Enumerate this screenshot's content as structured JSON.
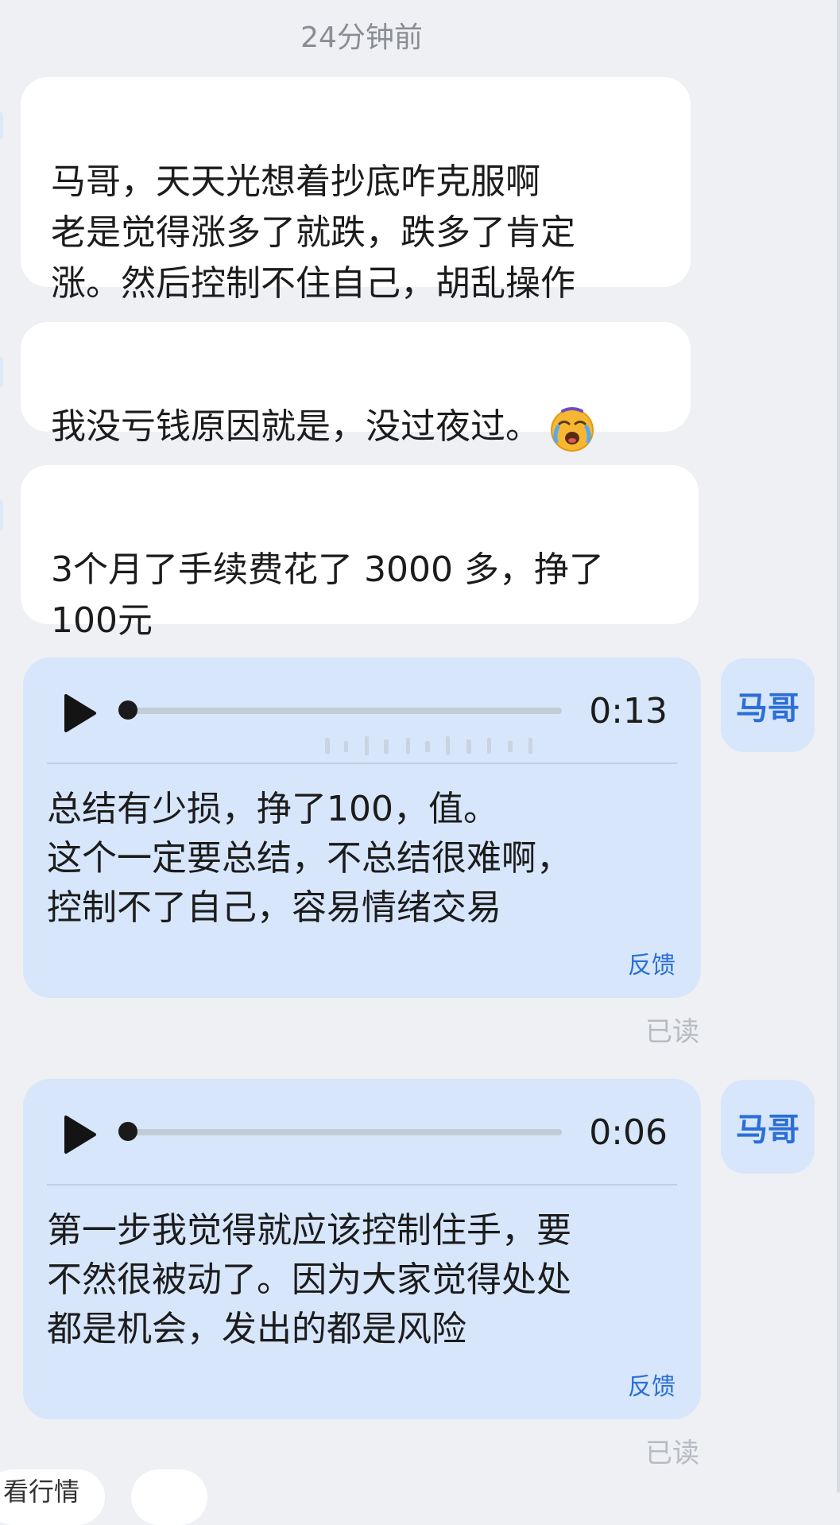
{
  "timestamp": "24分钟前",
  "incoming_messages": [
    {
      "text": "马哥，天天光想着抄底咋克服啊\n老是觉得涨多了就跌，跌多了肯定\n涨。然后控制不住自己，胡乱操作"
    },
    {
      "text": "我没亏钱原因就是，没过夜过。",
      "emoji": "crying-face-emoji"
    },
    {
      "text": "3个月了手续费花了 3000 多，挣了\n100元"
    }
  ],
  "voice_messages": [
    {
      "duration": "0:13",
      "progress": 0,
      "transcript": "总结有少损，挣了100，值。\n这个一定要总结，不总结很难啊，\n控制不了自己，容易情绪交易",
      "feedback_label": "反馈",
      "read_status": "已读",
      "avatar_label": "马哥"
    },
    {
      "duration": "0:06",
      "progress": 0,
      "transcript": "第一步我觉得就应该控制住手，要\n不然很被动了。因为大家觉得处处\n都是机会，发出的都是风险",
      "feedback_label": "反馈",
      "read_status": "已读",
      "avatar_label": "马哥"
    }
  ],
  "bottom_chips": [
    {
      "label": "看行情"
    },
    {
      "label": ""
    }
  ],
  "colors": {
    "background": "#eef0f3",
    "incoming_bubble": "#ffffff",
    "outgoing_bubble": "#d7e6fb",
    "accent": "#2b6fd6",
    "muted_text": "#8a8d93"
  }
}
